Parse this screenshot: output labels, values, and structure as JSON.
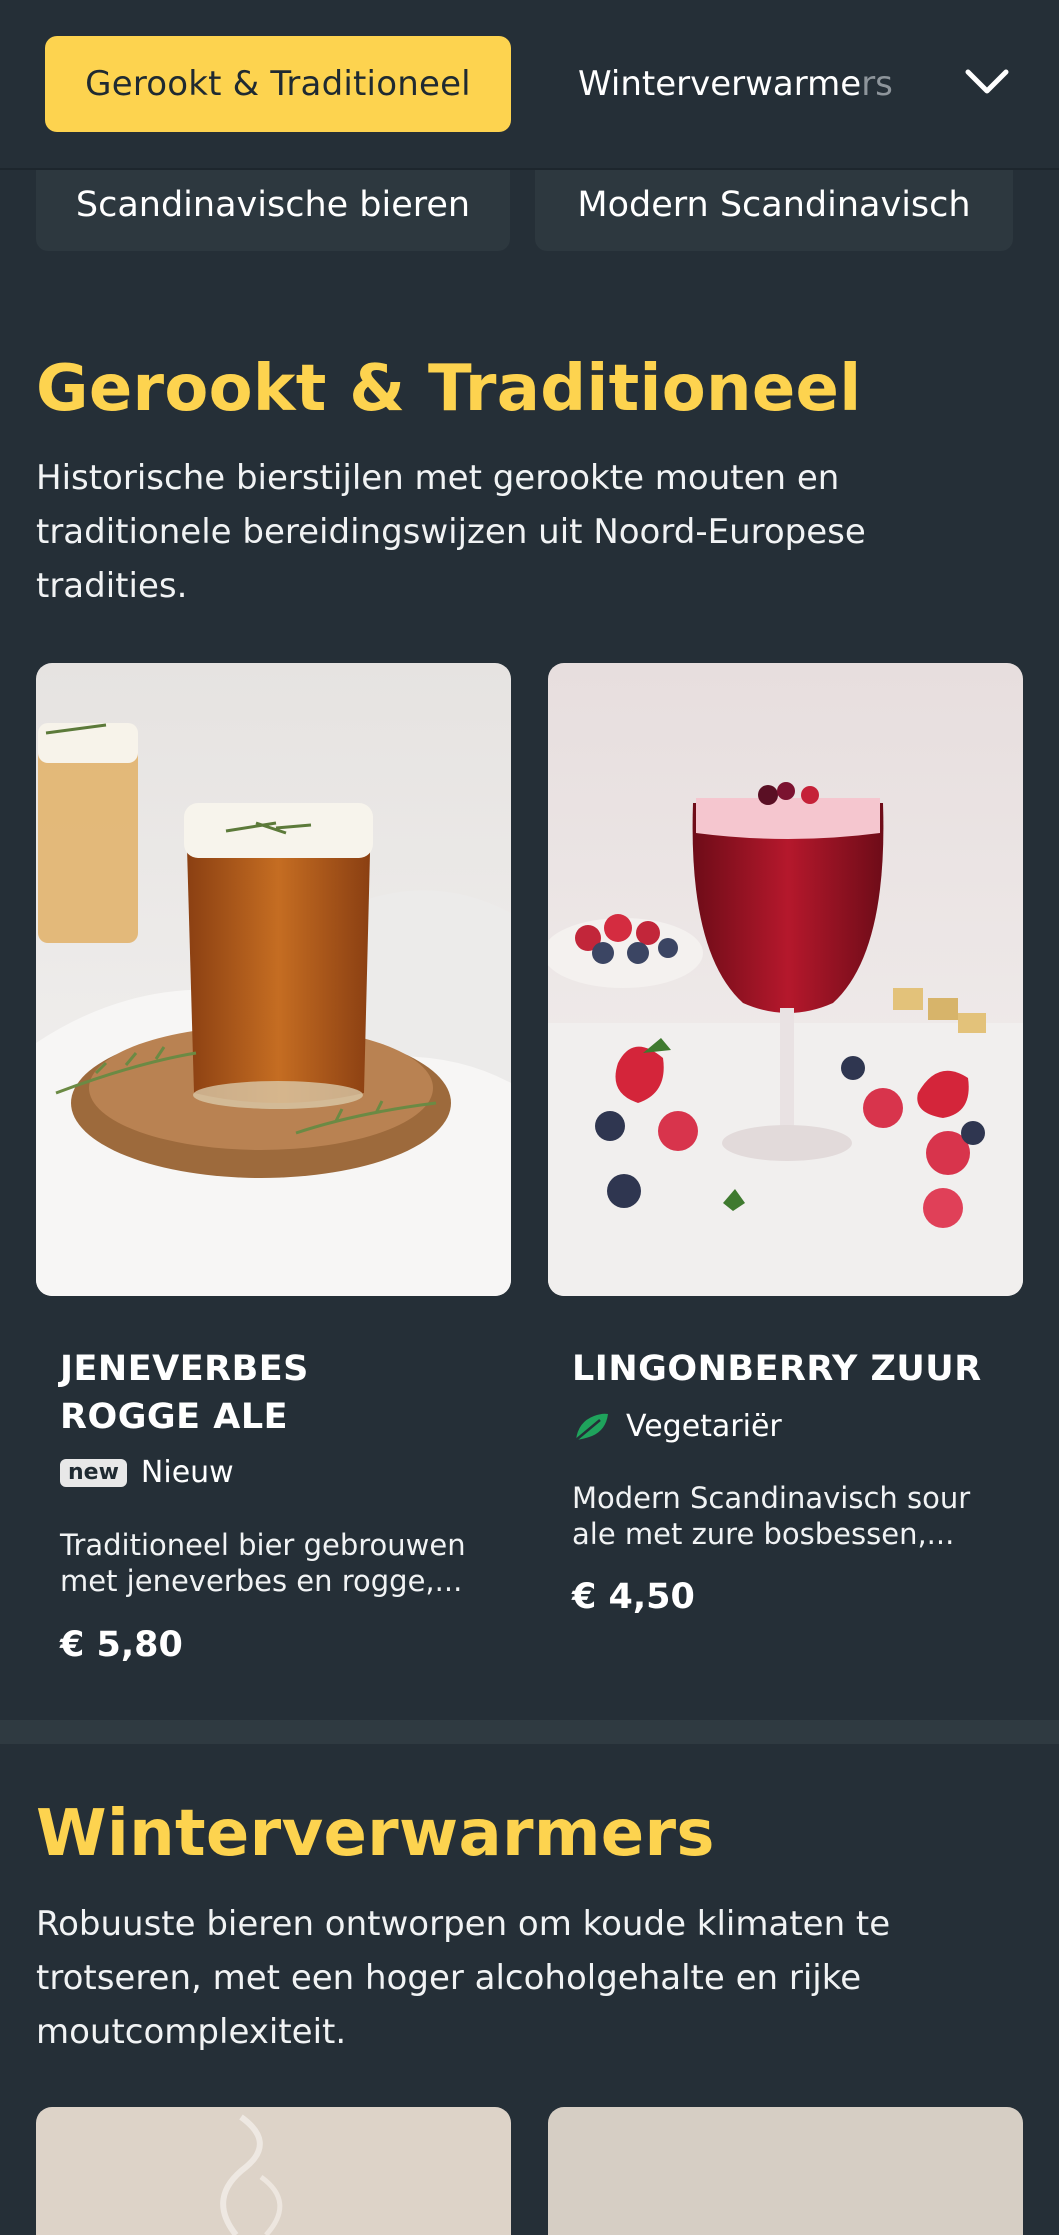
{
  "nav": {
    "active_tab": "Gerookt & Traditioneel",
    "next_tab_main": "Winterverwarme",
    "next_tab_fade": "rs",
    "chips": [
      "Scandinavische bieren",
      "Modern Scandinavisch"
    ]
  },
  "sections": [
    {
      "title": "Gerookt & Traditioneel",
      "description": "Historische bierstijlen met gerookte mouten en traditionele bereidingswijzen uit Noord-Europese tradities.",
      "products": [
        {
          "name": "JENEVERBES ROGGE ALE",
          "badge": "new",
          "badge_label": "Nieuw",
          "description": "Traditioneel bier gebrouwen met jeneverbes en rogge,...",
          "price": "€ 5,80"
        },
        {
          "name": "LINGONBERRY ZUUR",
          "badge_icon": "leaf-icon",
          "badge_label": "Vegetariër",
          "description": "Modern Scandinavisch sour ale met zure bosbessen,...",
          "price": "€ 4,50"
        }
      ]
    },
    {
      "title": "Winterverwarmers",
      "description": "Robuuste bieren ontworpen om koude klimaten te trotseren, met een hoger alcoholgehalte en rijke moutcomplexiteit."
    }
  ],
  "colors": {
    "background": "#252f37",
    "accent": "#fdd34f",
    "vegetarian_icon": "#1fa35c"
  }
}
